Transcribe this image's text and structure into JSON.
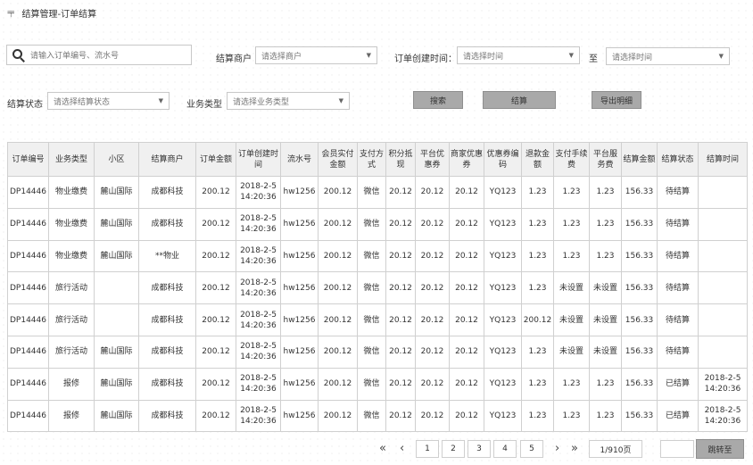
{
  "header": {
    "menu_icon": "menu-lines-icon",
    "title": "结算管理-订单结算"
  },
  "filters": {
    "search_placeholder": "请输入订单编号、流水号",
    "merchant_label": "结算商户",
    "merchant_placeholder": "请选择商户",
    "created_label": "订单创建时间：",
    "start_placeholder": "请选择时间",
    "to_label": "至",
    "end_placeholder": "请选择时间",
    "status_label": "结算状态",
    "status_placeholder": "请选择结算状态",
    "biz_label": "业务类型",
    "biz_placeholder": "请选择业务类型"
  },
  "buttons": {
    "search": "搜索",
    "settle": "结算",
    "export": "导出明细"
  },
  "table": {
    "headers": [
      "订单编号",
      "业务类型",
      "小区",
      "结算商户",
      "订单金额",
      "订单创建时间",
      "流水号",
      "会员实付金额",
      "支付方式",
      "积分抵现",
      "平台优惠券",
      "商家优惠券",
      "优惠券编码",
      "退款金额",
      "支付手续费",
      "平台服务费",
      "结算金额",
      "结算状态",
      "结算时间"
    ],
    "rows": [
      [
        "DP14446",
        "物业缴费",
        "麓山国际",
        "成都科技",
        "200.12",
        "2018-2-5 14:20:36",
        "hw1256",
        "200.12",
        "微信",
        "20.12",
        "20.12",
        "20.12",
        "YQ123",
        "1.23",
        "1.23",
        "1.23",
        "156.33",
        "待结算",
        ""
      ],
      [
        "DP14446",
        "物业缴费",
        "麓山国际",
        "成都科技",
        "200.12",
        "2018-2-5 14:20:36",
        "hw1256",
        "200.12",
        "微信",
        "20.12",
        "20.12",
        "20.12",
        "YQ123",
        "1.23",
        "1.23",
        "1.23",
        "156.33",
        "待结算",
        ""
      ],
      [
        "DP14446",
        "物业缴费",
        "麓山国际",
        "**物业",
        "200.12",
        "2018-2-5 14:20:36",
        "hw1256",
        "200.12",
        "微信",
        "20.12",
        "20.12",
        "20.12",
        "YQ123",
        "1.23",
        "1.23",
        "1.23",
        "156.33",
        "待结算",
        ""
      ],
      [
        "DP14446",
        "旅行活动",
        "",
        "成都科技",
        "200.12",
        "2018-2-5 14:20:36",
        "hw1256",
        "200.12",
        "微信",
        "20.12",
        "20.12",
        "20.12",
        "YQ123",
        "1.23",
        "未设置",
        "未设置",
        "156.33",
        "待结算",
        ""
      ],
      [
        "DP14446",
        "旅行活动",
        "",
        "成都科技",
        "200.12",
        "2018-2-5 14:20:36",
        "hw1256",
        "200.12",
        "微信",
        "20.12",
        "20.12",
        "20.12",
        "YQ123",
        "200.12",
        "未设置",
        "未设置",
        "156.33",
        "待结算",
        ""
      ],
      [
        "DP14446",
        "旅行活动",
        "麓山国际",
        "成都科技",
        "200.12",
        "2018-2-5 14:20:36",
        "hw1256",
        "200.12",
        "微信",
        "20.12",
        "20.12",
        "20.12",
        "YQ123",
        "1.23",
        "未设置",
        "未设置",
        "156.33",
        "待结算",
        ""
      ],
      [
        "DP14446",
        "报修",
        "麓山国际",
        "成都科技",
        "200.12",
        "2018-2-5 14:20:36",
        "hw1256",
        "200.12",
        "微信",
        "20.12",
        "20.12",
        "20.12",
        "YQ123",
        "1.23",
        "1.23",
        "1.23",
        "156.33",
        "已结算",
        "2018-2-5 14:20:36"
      ],
      [
        "DP14446",
        "报修",
        "麓山国际",
        "成都科技",
        "200.12",
        "2018-2-5 14:20:36",
        "hw1256",
        "200.12",
        "微信",
        "20.12",
        "20.12",
        "20.12",
        "YQ123",
        "1.23",
        "1.23",
        "1.23",
        "156.33",
        "已结算",
        "2018-2-5 14:20:36"
      ]
    ],
    "red_value": "未设置",
    "link_color": "#2f5fb8",
    "alert_color": "#e00000"
  },
  "pager": {
    "first": "«",
    "prev": "‹",
    "next": "›",
    "last": "»",
    "pages": [
      "1",
      "2",
      "3",
      "4",
      "5"
    ],
    "total": "1/910页",
    "jump": "跳转至"
  }
}
